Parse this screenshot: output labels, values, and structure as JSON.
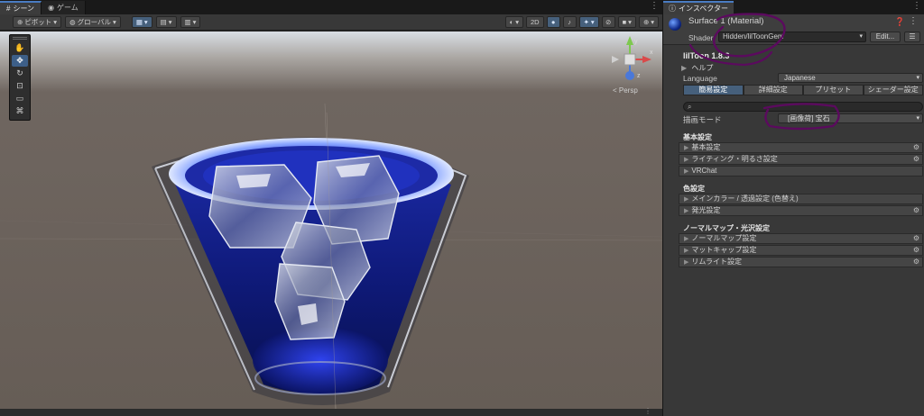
{
  "scene_window": {
    "tabs": [
      {
        "label": "シーン",
        "icon": "scene-icon",
        "active": true
      },
      {
        "label": "ゲーム",
        "icon": "game-icon",
        "active": false
      }
    ],
    "toolbar": {
      "pivot_label": "ピボット",
      "global_label": "グローバル",
      "twod_label": "2D"
    },
    "tools": [
      "hand-tool-icon",
      "move-tool-icon",
      "rotate-tool-icon",
      "scale-tool-icon",
      "rect-tool-icon",
      "transform-tool-icon"
    ],
    "gizmo": {
      "axis_y": "y",
      "axis_x": "x",
      "axis_z": "z",
      "projection": "< Persp"
    }
  },
  "inspector": {
    "tab_label": "インスペクター",
    "material": {
      "name": "Surface 1 (Material)",
      "shader_label": "Shader",
      "shader_value": "Hidden/lilToonGem",
      "edit_label": "Edit...",
      "list_label": "☰"
    },
    "liltoon_title": "lilToon 1.8.3",
    "help_label": "ヘルプ",
    "language_label": "Language",
    "language_value": "Japanese",
    "mode_tabs": [
      "簡易設定",
      "詳細設定",
      "プリセット",
      "シェーダー設定"
    ],
    "active_mode": 0,
    "search_placeholder": "",
    "render_mode_label": "描画モード",
    "render_mode_value": "[画像荷] 宝石",
    "sections": [
      {
        "title": "基本設定",
        "rows": [
          {
            "label": "基本設定",
            "gear": true
          },
          {
            "label": "ライティング・明るさ設定",
            "gear": true
          },
          {
            "label": "VRChat",
            "gear": false
          }
        ]
      },
      {
        "title": "色設定",
        "rows": [
          {
            "label": "メインカラー / 透過設定 (色替え)",
            "gear": false
          },
          {
            "label": "発光設定",
            "gear": true
          }
        ]
      },
      {
        "title": "ノーマルマップ・光沢設定",
        "rows": [
          {
            "label": "ノーマルマップ設定",
            "gear": true
          },
          {
            "label": "マットキャップ設定",
            "gear": true
          },
          {
            "label": "リムライト設定",
            "gear": true
          }
        ]
      }
    ]
  },
  "colors": {
    "accent_blue": "#46607c",
    "annotation_purple": "#5b0a5e",
    "glass_blue": "#1a2bb0"
  }
}
